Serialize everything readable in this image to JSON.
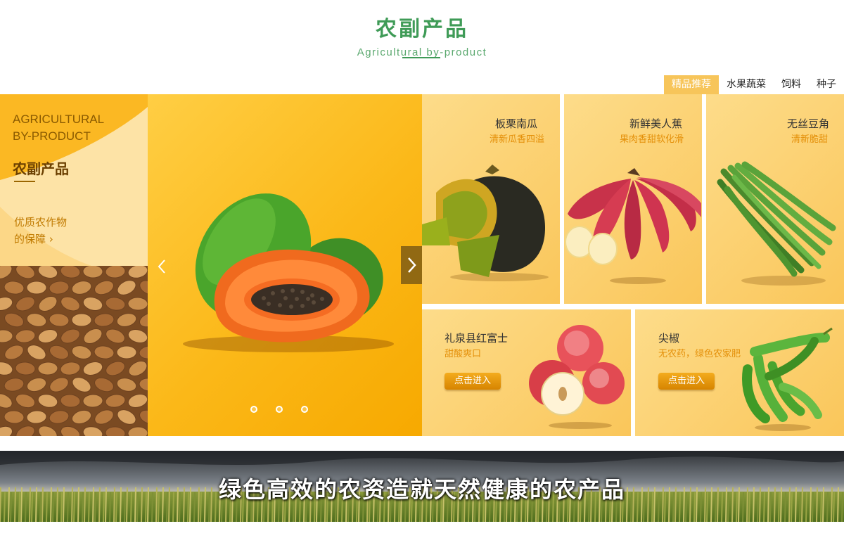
{
  "header": {
    "title": "农副产品",
    "subtitle": "Agricultural by-product"
  },
  "tabs": [
    {
      "label": "精品推荐",
      "active": true
    },
    {
      "label": "水果蔬菜",
      "active": false
    },
    {
      "label": "饲料",
      "active": false
    },
    {
      "label": "种子",
      "active": false
    }
  ],
  "left_panel": {
    "en_line1": "AGRICULTURAL",
    "en_line2": "BY-PRODUCT",
    "title": "农副产品",
    "sub_line1": "优质农作物",
    "sub_line2": "的保障",
    "link_arrow": "›"
  },
  "carousel": {
    "slide_count": 3,
    "active_index": 0,
    "arrow_left": "‹",
    "arrow_right": "›"
  },
  "products": [
    {
      "name": "板栗南瓜",
      "desc": "清新瓜香四溢",
      "icon": "pumpkin"
    },
    {
      "name": "新鲜美人蕉",
      "desc": "果肉香甜软化滑",
      "icon": "red-banana"
    },
    {
      "name": "无丝豆角",
      "desc": "清新脆甜",
      "icon": "green-beans"
    },
    {
      "name": "礼泉县红富士",
      "desc": "甜酸爽口",
      "button": "点击进入",
      "icon": "apple"
    },
    {
      "name": "尖椒",
      "desc": "无农药，绿色农家肥",
      "button": "点击进入",
      "icon": "green-pepper"
    }
  ],
  "banner": {
    "text": "绿色高效的农资造就天然健康的农产品"
  },
  "colors": {
    "brand_green": "#3f9b57",
    "accent_orange": "#f7c55a",
    "card_yellow": "#fddc8a"
  }
}
